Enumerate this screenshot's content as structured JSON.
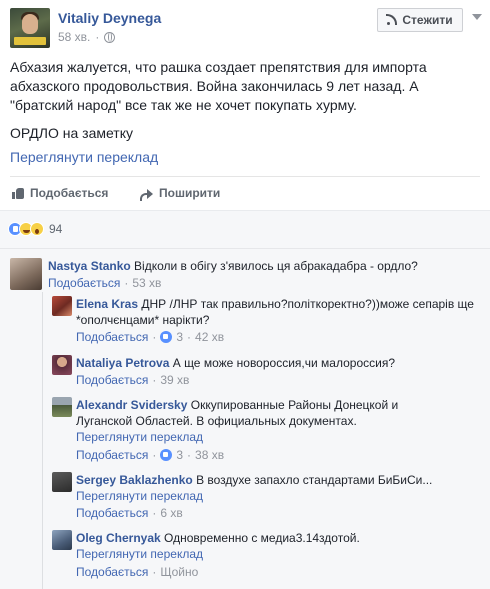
{
  "post": {
    "author": "Vitaliy Deynega",
    "time": "58 хв.",
    "follow_label": "Стежити",
    "text_p1": "Абхазия жалуется, что рашка создает препятствия для импорта абхазского продовольствия. Война закончилась 9 лет назад. А \"братский народ\" все так же не хочет покупать хурму.",
    "text_p2": "ОРДЛО на заметку",
    "see_translation": "Переглянути переклад",
    "like_label": "Подобається",
    "share_label": "Поширити",
    "reaction_count": "94",
    "reactions": [
      "like",
      "haha",
      "wow"
    ]
  },
  "comments": [
    {
      "author": "Nastya Stanko",
      "text": "Відколи в обігу з'явилось ця абракадабра - ордло?",
      "like_label": "Подобається",
      "time": "53 хв",
      "replies": [
        {
          "author": "Elena Kras",
          "text": "ДНР /ЛНР так правильно?політкоректно?))може сепарів ще *ополчєнцами* нарікти?",
          "like_label": "Подобається",
          "likes": "3",
          "time": "42 хв"
        },
        {
          "author": "Nataliya Petrova",
          "text": "А ще може новороссия,чи малороссия?",
          "like_label": "Подобається",
          "time": "39 хв"
        },
        {
          "author": "Alexandr Svidersky",
          "text": "Оккупированные Районы Донецкой и Луганской Областей. В официальных документах.",
          "see_translation": "Переглянути переклад",
          "like_label": "Подобається",
          "likes": "3",
          "time": "38 хв"
        },
        {
          "author": "Sergey Baklazhenko",
          "text": "В воздухе запахло стандартами БиБиСи...",
          "see_translation": "Переглянути переклад",
          "like_label": "Подобається",
          "time": "6 хв"
        },
        {
          "author": "Oleg Chernyak",
          "text": "Одновременно с медиа3.14здотой.",
          "see_translation": "Переглянути переклад",
          "like_label": "Подобається",
          "time": "Щойно"
        }
      ]
    }
  ],
  "colors": {
    "link": "#365899",
    "secondary_link": "#4267b2",
    "muted": "#90949c",
    "comment_bg": "#f6f7f9"
  }
}
